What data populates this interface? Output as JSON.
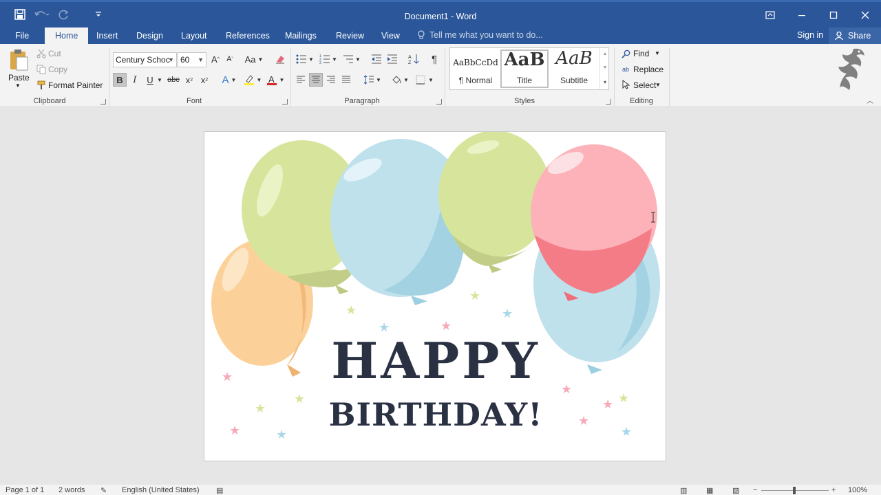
{
  "window": {
    "title": "Document1 - Word",
    "accent": "#2b579a"
  },
  "quick_access": {
    "save_icon": "save-icon",
    "undo_icon": "undo-icon",
    "redo_icon": "redo-icon",
    "customize_icon": "customize-qat-icon"
  },
  "tabs": {
    "file": "File",
    "home": "Home",
    "insert": "Insert",
    "design": "Design",
    "layout": "Layout",
    "references": "References",
    "mailings": "Mailings",
    "review": "Review",
    "view": "View",
    "tell_me": "Tell me what you want to do...",
    "sign_in": "Sign in",
    "share": "Share"
  },
  "ribbon": {
    "clipboard": {
      "label": "Clipboard",
      "paste": "Paste",
      "cut": "Cut",
      "copy": "Copy",
      "format_painter": "Format Painter"
    },
    "font": {
      "label": "Font",
      "font_name": "Century Schoc",
      "font_size": "60",
      "change_case": "Aa"
    },
    "paragraph": {
      "label": "Paragraph"
    },
    "styles": {
      "label": "Styles",
      "items": [
        {
          "preview": "AaBbCcDd",
          "name": "¶ Normal"
        },
        {
          "preview": "AaB",
          "name": "Title"
        },
        {
          "preview": "AaB",
          "name": "Subtitle"
        }
      ]
    },
    "editing": {
      "label": "Editing",
      "find": "Find",
      "replace": "Replace",
      "select": "Select"
    }
  },
  "document": {
    "line1": "HAPPY",
    "line2": "BIRTHDAY!",
    "text_color": "#2a3143"
  },
  "status": {
    "page": "Page 1 of 1",
    "words": "2 words",
    "language": "English (United States)",
    "zoom": "100%"
  }
}
